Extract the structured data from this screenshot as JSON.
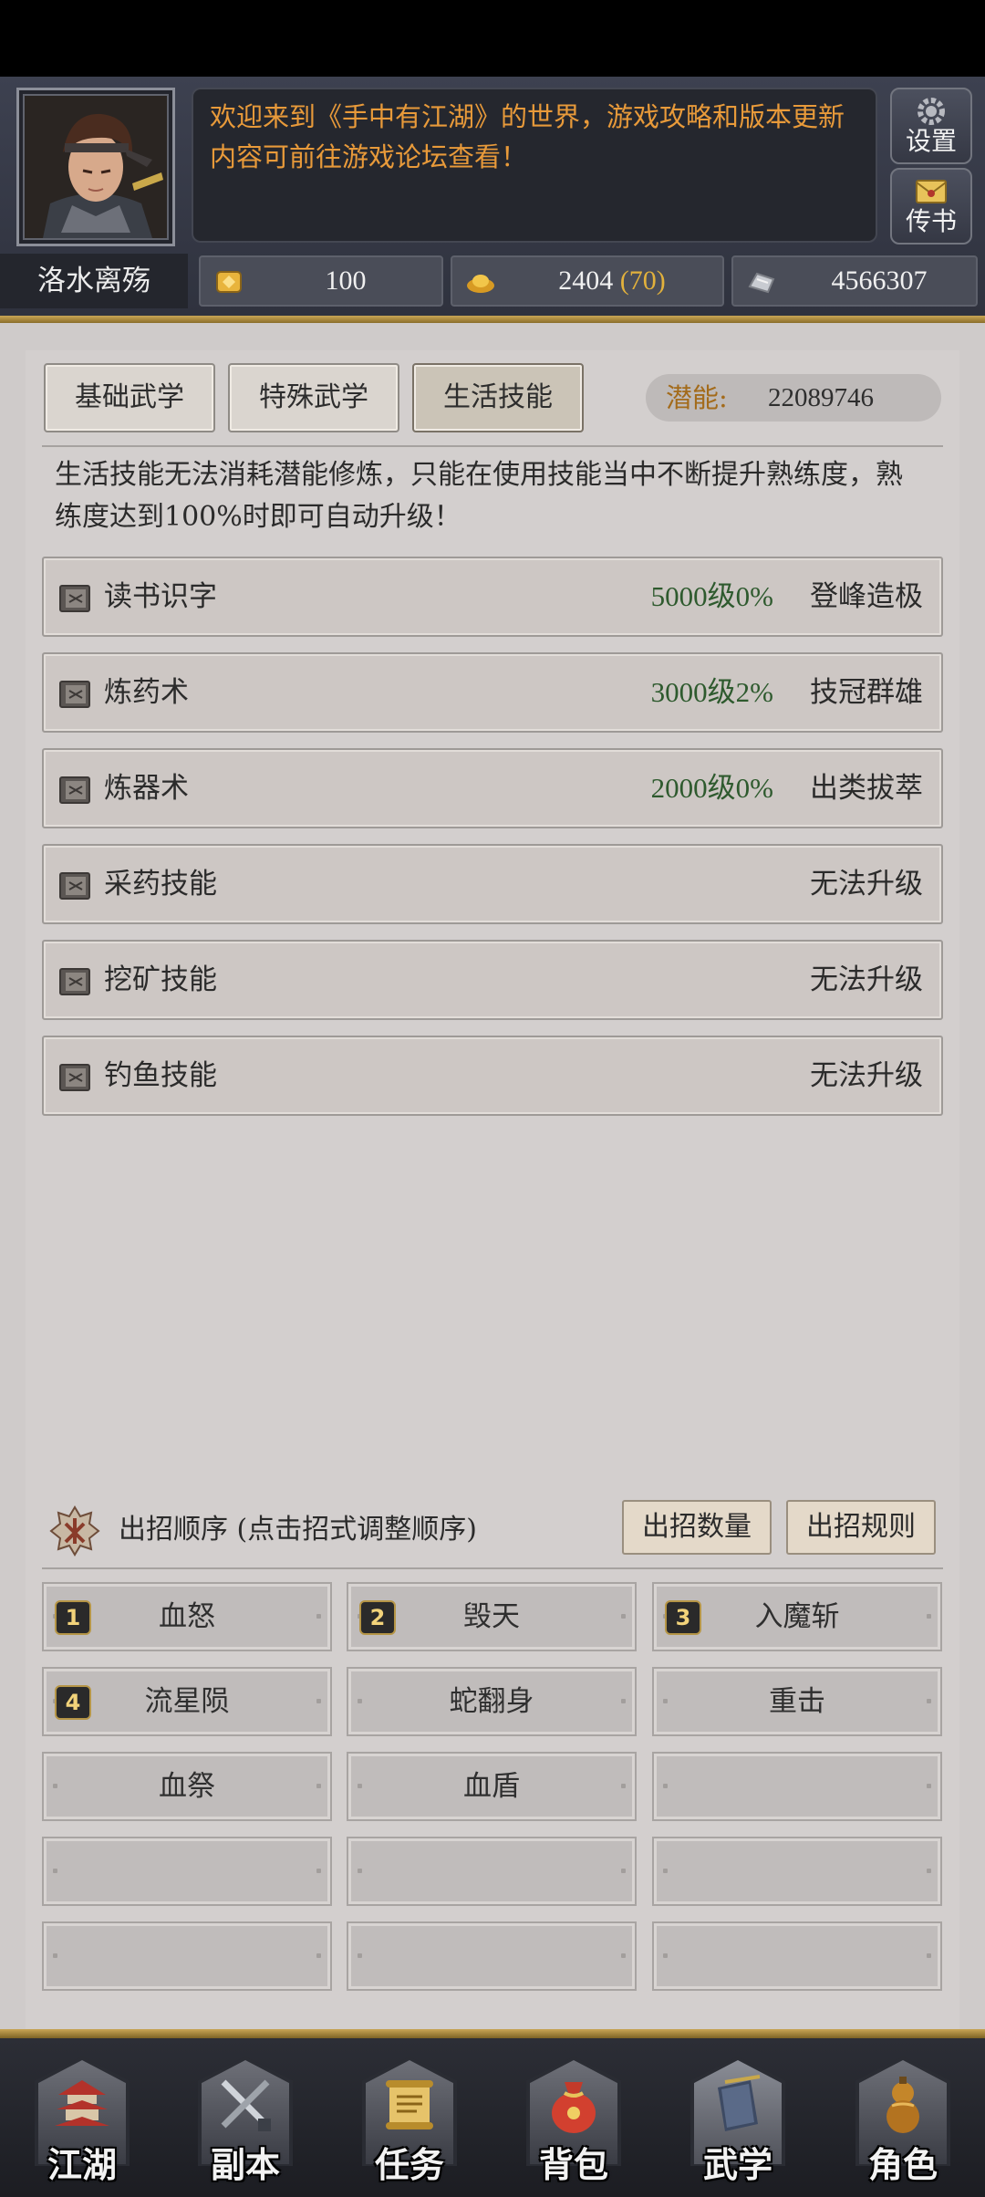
{
  "player": {
    "name": "洛水离殇"
  },
  "notice": {
    "text": "欢迎来到《手中有江湖》的世界，游戏攻略和版本更新内容可前往游戏论坛查看！"
  },
  "side_buttons": {
    "settings_label": "设置",
    "mail_label": "传书"
  },
  "resources": {
    "tokens": "100",
    "ingots": "2404",
    "ingots_extra": "(70)",
    "silver": "4566307"
  },
  "tabs": [
    {
      "label": "基础武学",
      "active": false
    },
    {
      "label": "特殊武学",
      "active": false
    },
    {
      "label": "生活技能",
      "active": true
    }
  ],
  "potential": {
    "label": "潜能:",
    "value": "22089746"
  },
  "description": "生活技能无法消耗潜能修炼，只能在使用技能当中不断提升熟练度，熟练度达到100%时即可自动升级！",
  "skills": [
    {
      "name": "读书识字",
      "level": "5000级0%",
      "rank": "登峰造极"
    },
    {
      "name": "炼药术",
      "level": "3000级2%",
      "rank": "技冠群雄"
    },
    {
      "name": "炼器术",
      "level": "2000级0%",
      "rank": "出类拔萃"
    },
    {
      "name": "采药技能",
      "level": "",
      "rank": "无法升级"
    },
    {
      "name": "挖矿技能",
      "level": "",
      "rank": "无法升级"
    },
    {
      "name": "钓鱼技能",
      "level": "",
      "rank": "无法升级"
    }
  ],
  "moves": {
    "title": "出招顺序 (点击招式调整顺序)",
    "count_button": "出招数量",
    "rules_button": "出招规则",
    "slots": [
      {
        "badge": "1",
        "name": "血怒"
      },
      {
        "badge": "2",
        "name": "毁天"
      },
      {
        "badge": "3",
        "name": "入魔斩"
      },
      {
        "badge": "4",
        "name": "流星陨"
      },
      {
        "badge": "",
        "name": "蛇翻身"
      },
      {
        "badge": "",
        "name": "重击"
      },
      {
        "badge": "",
        "name": "血祭"
      },
      {
        "badge": "",
        "name": "血盾"
      },
      {
        "badge": "",
        "name": ""
      },
      {
        "badge": "",
        "name": ""
      },
      {
        "badge": "",
        "name": ""
      },
      {
        "badge": "",
        "name": ""
      },
      {
        "badge": "",
        "name": ""
      },
      {
        "badge": "",
        "name": ""
      },
      {
        "badge": "",
        "name": ""
      }
    ]
  },
  "nav": [
    {
      "label": "江湖",
      "icon": "pagoda-icon"
    },
    {
      "label": "副本",
      "icon": "crossed-swords-icon"
    },
    {
      "label": "任务",
      "icon": "scroll-icon"
    },
    {
      "label": "背包",
      "icon": "pouch-icon"
    },
    {
      "label": "武学",
      "icon": "book-icon",
      "active": true
    },
    {
      "label": "角色",
      "icon": "gourd-icon"
    }
  ],
  "colors": {
    "notice_text": "#e89a3a",
    "level_text": "#2e5a2e",
    "potential_label": "#a36b1b",
    "gold_accent": "#c9a555",
    "ingot_extra": "#e2b13c"
  }
}
